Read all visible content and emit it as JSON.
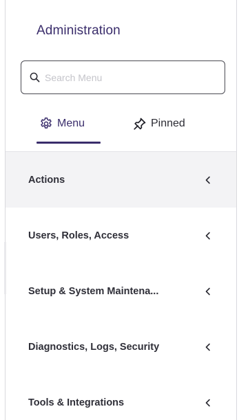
{
  "header": {
    "title": "Administration"
  },
  "search": {
    "placeholder": "Search Menu",
    "value": ""
  },
  "tabs": [
    {
      "label": "Menu",
      "icon": "gear-icon",
      "active": true
    },
    {
      "label": "Pinned",
      "icon": "pin-icon",
      "active": false
    }
  ],
  "menu": {
    "items": [
      {
        "label": "Actions",
        "expanded": false,
        "highlighted": true
      },
      {
        "label": "Users, Roles, Access",
        "expanded": false,
        "highlighted": false
      },
      {
        "label": "Setup & System Maintena...",
        "expanded": false,
        "highlighted": false
      },
      {
        "label": "Diagnostics, Logs, Security",
        "expanded": false,
        "highlighted": false
      },
      {
        "label": "Tools & Integrations",
        "expanded": false,
        "highlighted": false
      }
    ]
  },
  "colors": {
    "accent": "#3a2d6b",
    "text": "#2f2f38",
    "border": "#4a4a52",
    "highlight_row": "#f3f3f5"
  }
}
